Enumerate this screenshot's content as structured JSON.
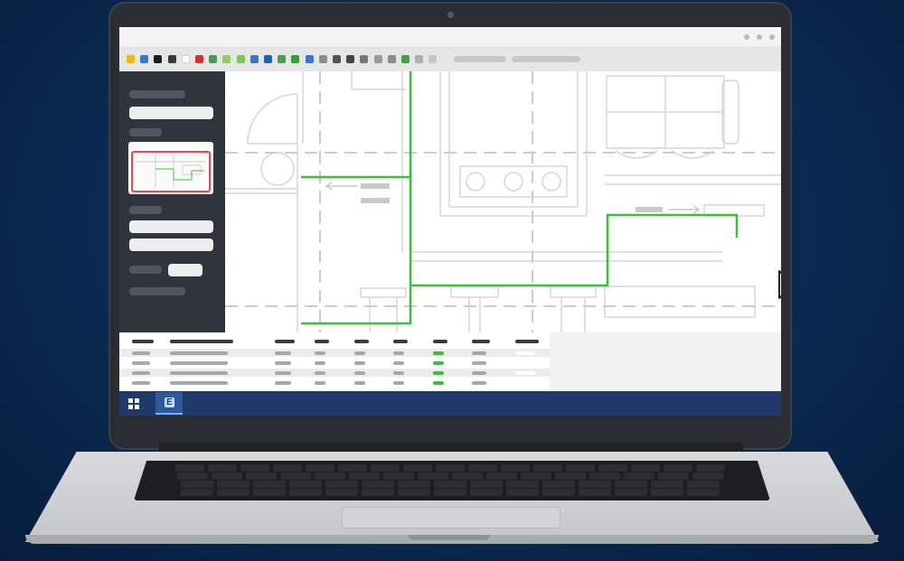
{
  "app": {
    "name": "floor-plan-editor",
    "cursor": "arrow-cursor"
  },
  "palette": [
    "#f5b800",
    "#2f7ad6",
    "#1e1e1e",
    "#3a3a3a",
    "#ffffff",
    "#d62d2d",
    "#3fa53f",
    "#8bd25a",
    "#7acb4a",
    "#2f7ad6",
    "#1f5fb8",
    "#3fa53f",
    "#2aa52a",
    "#2f7ad6",
    "#8c8c8c",
    "#555555",
    "#444444",
    "#777777",
    "#999999",
    "#8c8c8c",
    "#3fa53f",
    "#b0b0b0",
    "#c7c7c7"
  ],
  "colors": {
    "route_highlight": "#3dbf3d",
    "selection_frame": "#e84a4a",
    "sidebar_bg": "#30343c",
    "taskbar_bg": "#1f3a6a",
    "status_green": "#3dbf3d"
  },
  "taskbar": {
    "start_icon": "windows-logo-icon",
    "app_icon": "app-e-icon",
    "app_glyph": "E"
  },
  "table": {
    "columns": 8,
    "rows": 4,
    "status_column": 6
  }
}
